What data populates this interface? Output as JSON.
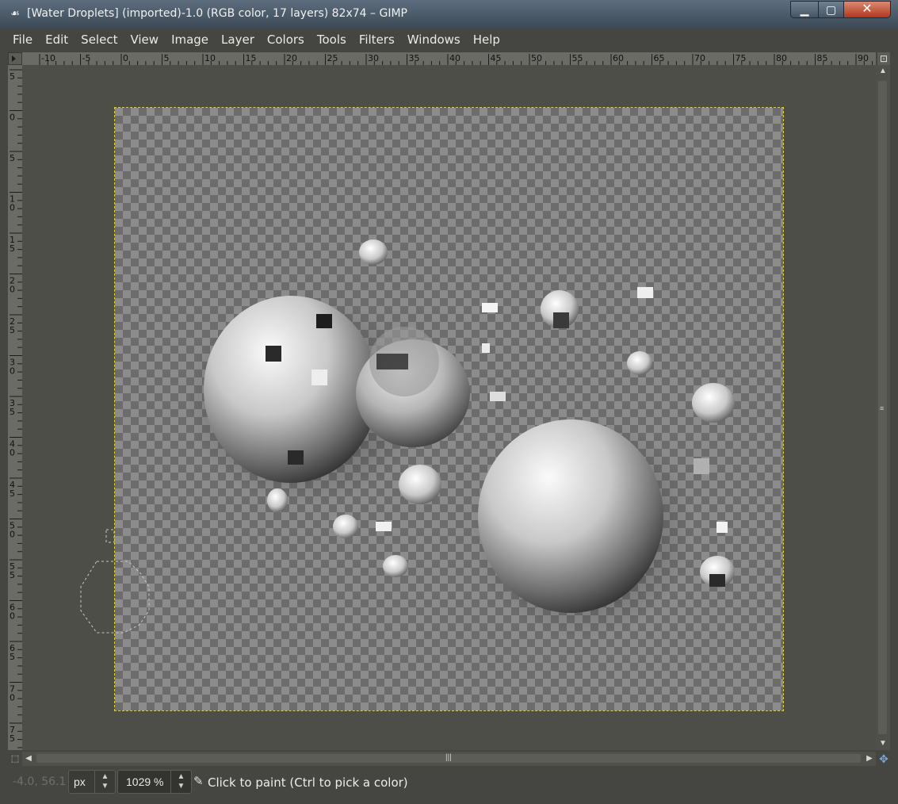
{
  "window": {
    "title": "[Water Droplets] (imported)-1.0 (RGB color, 17 layers) 82x74 – GIMP",
    "minimize_label": "▁",
    "maximize_label": "▢",
    "close_label": "✕"
  },
  "menu": {
    "items": [
      {
        "id": "file",
        "label": "File"
      },
      {
        "id": "edit",
        "label": "Edit"
      },
      {
        "id": "select",
        "label": "Select"
      },
      {
        "id": "view",
        "label": "View"
      },
      {
        "id": "image",
        "label": "Image"
      },
      {
        "id": "layer",
        "label": "Layer"
      },
      {
        "id": "colors",
        "label": "Colors"
      },
      {
        "id": "tools",
        "label": "Tools"
      },
      {
        "id": "filters",
        "label": "Filters"
      },
      {
        "id": "windows",
        "label": "Windows"
      },
      {
        "id": "help",
        "label": "Help"
      }
    ]
  },
  "rulers": {
    "horizontal_labels": [
      "-10",
      "-5",
      "0",
      "5",
      "10",
      "15",
      "20",
      "25",
      "30",
      "35",
      "40",
      "45",
      "50",
      "55",
      "60",
      "65",
      "70",
      "75",
      "80",
      "85",
      "90"
    ],
    "vertical_labels": [
      "5",
      "0",
      "5",
      "10",
      "15",
      "20",
      "25",
      "30",
      "35",
      "40",
      "45",
      "50",
      "55",
      "60",
      "65",
      "70",
      "75"
    ]
  },
  "image": {
    "colors": {
      "checker_light": "#8c8c8c",
      "checker_dark": "#6c6c6c",
      "canvas_border": "#e6d21a",
      "canvas_background": "#4d4e48"
    }
  },
  "statusbar": {
    "pointer_coords": "-4.0, 56.1",
    "unit": "px",
    "zoom": "1029 %",
    "message": "Click to paint (Ctrl to pick a color)",
    "tool_icon": "pencil-icon"
  }
}
